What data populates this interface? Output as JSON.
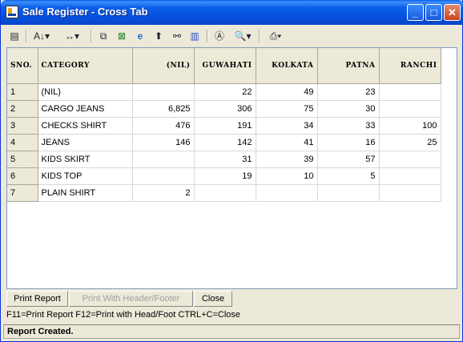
{
  "window": {
    "title": "Sale Register - Cross Tab"
  },
  "title_buttons": {
    "minimize": "_",
    "maximize": "□",
    "close": "✕"
  },
  "toolbar": {
    "icons": [
      "report-icon",
      "sort-icon",
      "column-width-icon",
      "copy-icon",
      "excel-icon",
      "browser-icon",
      "up-arrow-icon",
      "find-icon",
      "chart-icon",
      "font-icon",
      "preview-icon",
      "print-icon"
    ]
  },
  "grid": {
    "columns": [
      "SNO.",
      "CATEGORY",
      "(NIL)",
      "GUWAHATI",
      "KOLKATA",
      "PATNA",
      "RANCHI"
    ],
    "rows": [
      [
        "1",
        "(NIL)",
        "",
        "22",
        "49",
        "23",
        ""
      ],
      [
        "2",
        "CARGO JEANS",
        "6,825",
        "306",
        "75",
        "30",
        ""
      ],
      [
        "3",
        "CHECKS SHIRT",
        "476",
        "191",
        "34",
        "33",
        "100"
      ],
      [
        "4",
        "JEANS",
        "146",
        "142",
        "41",
        "16",
        "25"
      ],
      [
        "5",
        "KIDS SKIRT",
        "",
        "31",
        "39",
        "57",
        ""
      ],
      [
        "6",
        "KIDS TOP",
        "",
        "19",
        "10",
        "5",
        ""
      ],
      [
        "7",
        "PLAIN SHIRT",
        "2",
        "",
        "",
        "",
        ""
      ]
    ]
  },
  "buttons": {
    "print_report": "Print Report",
    "print_header_footer": "Print With Header/Footer",
    "close": "Close"
  },
  "hint": "F11=Print Report  F12=Print with Head/Foot  CTRL+C=Close",
  "status": "Report Created."
}
